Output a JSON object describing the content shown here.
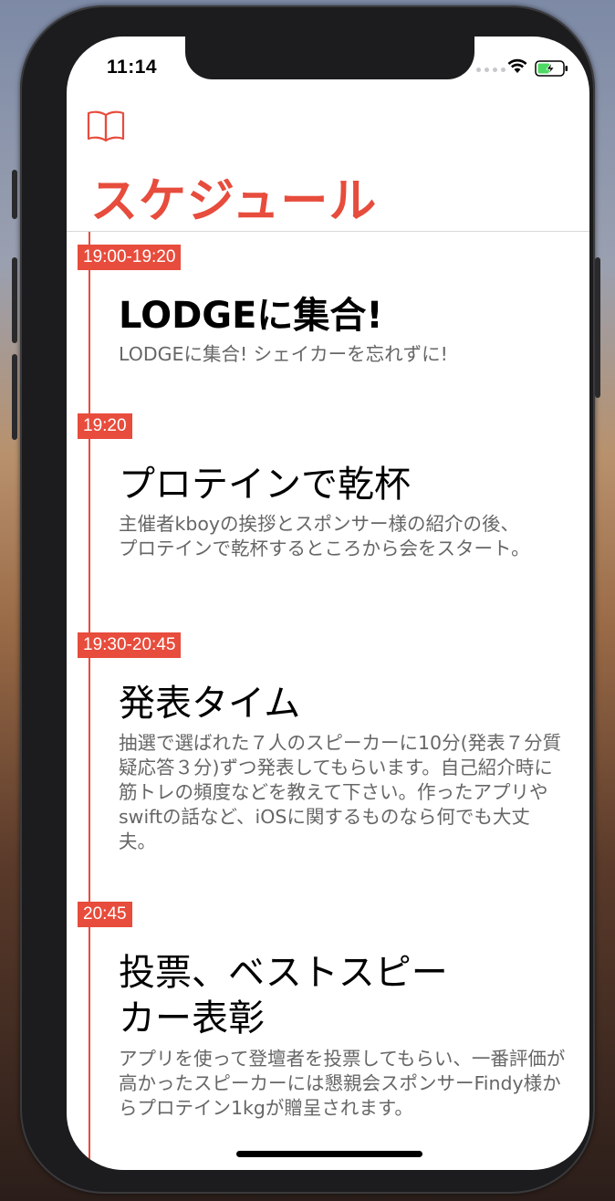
{
  "status_bar": {
    "time": "11:14"
  },
  "header": {
    "title": "スケジュール",
    "book_icon": "book-icon"
  },
  "schedule": [
    {
      "time": "19:00-19:20",
      "title": "LODGEに集合!",
      "description": "LODGEに集合! シェイカーを忘れずに!"
    },
    {
      "time": "19:20",
      "title": "プロテインで乾杯",
      "description": "主催者kboyの挨拶とスポンサー様の紹介の後、プロテインで乾杯するところから会をスタート。"
    },
    {
      "time": "19:30-20:45",
      "title": "発表タイム",
      "description": "抽選で選ばれた７人のスピーカーに10分(発表７分質疑応答３分)ずつ発表してもらいます。自己紹介時に筋トレの頻度などを教えて下さい。作ったアプリやswiftの話など、iOSに関するものなら何でも大丈夫。"
    },
    {
      "time": "20:45",
      "title": "投票、ベストスピーカー表彰",
      "description": "アプリを使って登壇者を投票してもらい、一番評価が高かったスピーカーには懇親会スポンサーFindy様からプロテイン1kgが贈呈されます。"
    }
  ],
  "colors": {
    "accent": "#e74c3c",
    "description": "#666666",
    "title": "#000000"
  }
}
